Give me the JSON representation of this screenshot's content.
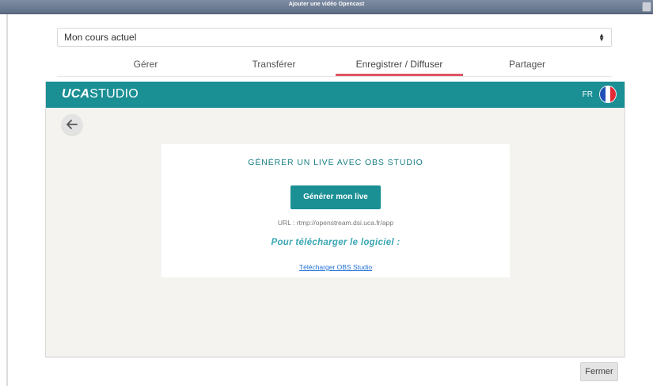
{
  "window": {
    "title": "Ajouter une vidéo Opencast"
  },
  "course_select": {
    "value": "Mon cours actuel"
  },
  "tabs": [
    {
      "label": "Gérer",
      "active": false
    },
    {
      "label": "Transférer",
      "active": false
    },
    {
      "label": "Enregistrer / Diffuser",
      "active": true
    },
    {
      "label": "Partager",
      "active": false
    }
  ],
  "uca_header": {
    "logo_bold": "UCA",
    "logo_rest": "STUDIO",
    "lang": "FR",
    "flag_icon": "france-flag-icon",
    "brand_color": "#1a8f94"
  },
  "back": {
    "icon": "arrow-left-icon"
  },
  "live_card": {
    "title": "GÉNÉRER UN LIVE AVEC OBS STUDIO",
    "button_label": "Générer mon live",
    "url_text": "URL : rtmp://openstream.dsi.uca.fr/app",
    "download_label": "Pour télécharger le logiciel :",
    "download_link": "Télécharger OBS Studio"
  },
  "footer": {
    "close_label": "Fermer"
  },
  "colors": {
    "accent_tab": "#e05463",
    "teal": "#1a8f94",
    "link": "#1f6fd6"
  }
}
